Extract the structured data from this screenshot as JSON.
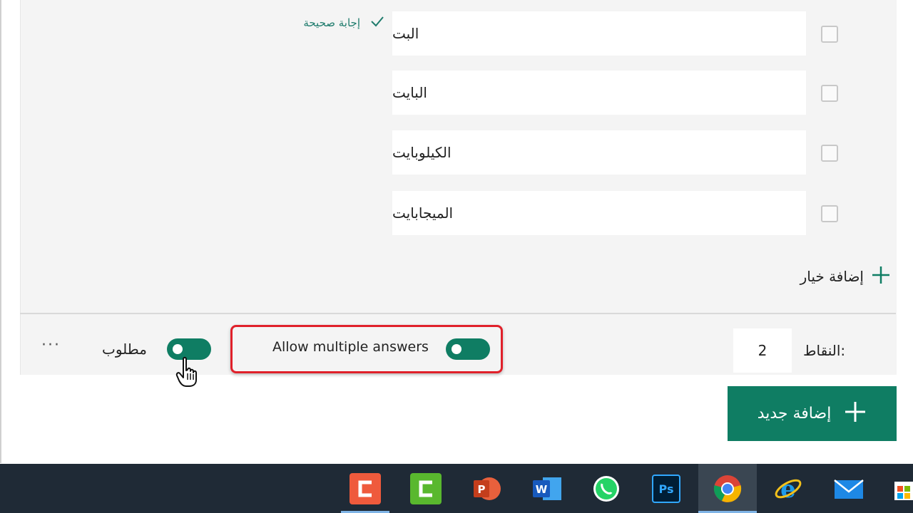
{
  "options": [
    {
      "text": "البت",
      "correct": true
    },
    {
      "text": "البايت",
      "correct": false
    },
    {
      "text": "الكيلوبايت",
      "correct": false
    },
    {
      "text": "الميجابايت",
      "correct": false
    }
  ],
  "correct_answer_label": "إجابة صحيحة",
  "add_option_label": "إضافة خيار",
  "points": {
    "label": "النقاط:",
    "value": "2"
  },
  "multiple_answers": {
    "label": "Allow multiple answers",
    "enabled": true
  },
  "required": {
    "label": "مطلوب",
    "enabled": true
  },
  "more_label": "···",
  "add_new_label": "إضافة جديد",
  "colors": {
    "accent": "#0f7d63",
    "highlight": "#e0202a"
  },
  "taskbar": {
    "apps": [
      "camtasia-recorder-icon",
      "camtasia-editor-icon",
      "powerpoint-icon",
      "word-icon",
      "whatsapp-icon",
      "photoshop-icon",
      "chrome-icon",
      "internet-explorer-icon",
      "mail-icon",
      "store-icon"
    ]
  }
}
